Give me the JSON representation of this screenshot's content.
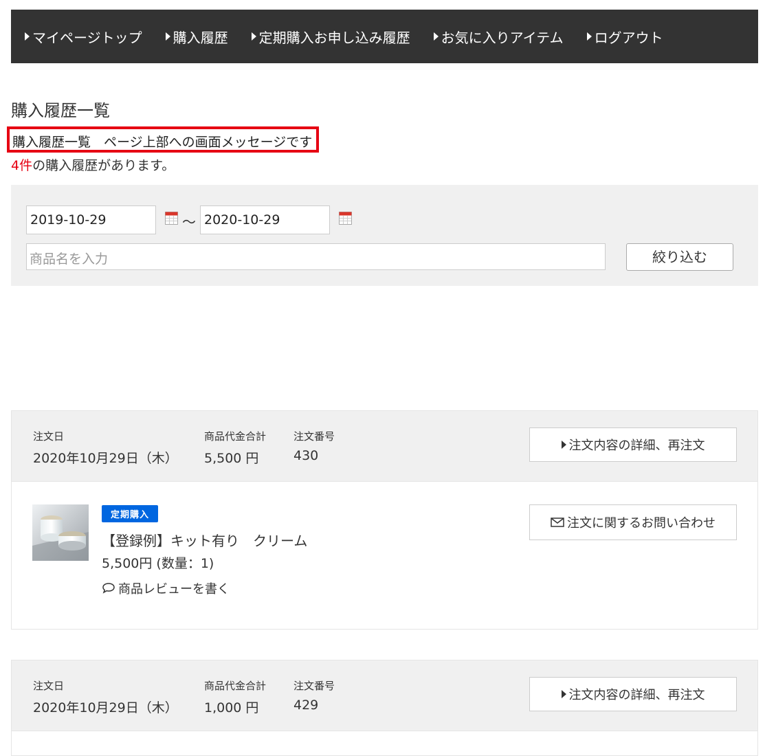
{
  "nav": {
    "items": [
      {
        "label": "マイページトップ"
      },
      {
        "label": "購入履歴"
      },
      {
        "label": "定期購入お申し込み履歴"
      },
      {
        "label": "お気に入りアイテム"
      },
      {
        "label": "ログアウト"
      }
    ]
  },
  "page": {
    "title": "購入履歴一覧",
    "notice": "購入履歴一覧　ページ上部への画面メッセージです",
    "count": "4件",
    "count_suffix": "の購入履歴があります。"
  },
  "search": {
    "date_from": "2019-10-29",
    "date_to": "2020-10-29",
    "tilde": "～",
    "product_placeholder": "商品名を入力",
    "filter_label": "絞り込む"
  },
  "labels": {
    "order_date": "注文日",
    "total": "商品代金合計",
    "order_no": "注文番号",
    "detail_button": "注文内容の詳細、再注文",
    "contact_button": "注文に関するお問い合わせ",
    "review_link": "商品レビューを書く"
  },
  "orders": [
    {
      "date": "2020年10月29日（木）",
      "total": "5,500 円",
      "number": "430",
      "item": {
        "badge": "定期購入",
        "name": "【登録例】キット有り　クリーム",
        "price": "5,500円 (数量：1)"
      }
    },
    {
      "date": "2020年10月29日（木）",
      "total": "1,000 円",
      "number": "429"
    }
  ],
  "colors": {
    "nav_bg": "#333333",
    "accent_red": "#e60012",
    "badge_blue": "#0066e0",
    "panel_bg": "#f0f0f0"
  }
}
